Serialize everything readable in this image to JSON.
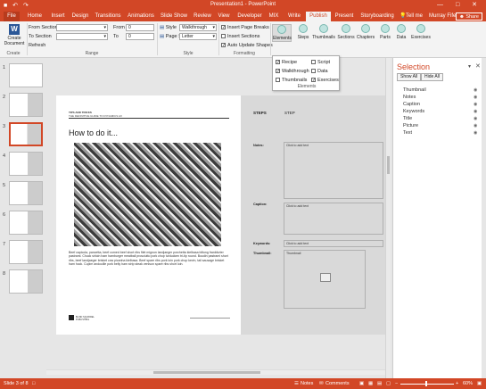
{
  "window": {
    "title": "Presentation1 - PowerPoint",
    "quick_access": "■ ↶ ↷",
    "controls": "— □ ✕"
  },
  "tabs": [
    "File",
    "Home",
    "Insert",
    "Design",
    "Transitions",
    "Animations",
    "Slide Show",
    "Review",
    "View",
    "Developer",
    "MIX",
    "Write",
    "Publish",
    "Present",
    "Storyboarding"
  ],
  "active_tab": "Publish",
  "tell_me": "Tell me",
  "user": "Murray Fife",
  "share": "Share",
  "ribbon": {
    "create_label": "Create Document",
    "group_create": "Create",
    "from_section": "From Section",
    "to_section": "To Section",
    "refresh": "Refresh",
    "from_label": "From",
    "from_value": "0",
    "to_label": "To",
    "to_value": "0",
    "group_range": "Range",
    "style_label": "Style",
    "style_value": "Walkthrough",
    "page_size_label": "Page Size",
    "page_size_value": "Letter",
    "group_style": "Style",
    "insert_page_breaks": "Insert Page Breaks",
    "insert_sections": "Insert Sections",
    "auto_update_shapes": "Auto Update Shapes",
    "group_formatting": "Formatting",
    "buttons": [
      "Elements",
      "Steps",
      "Thumbnails",
      "Sections",
      "Chapters",
      "Parts",
      "Data",
      "Exercises"
    ]
  },
  "elements_menu": {
    "items": [
      {
        "label": "Recipe",
        "checked": true
      },
      {
        "label": "Script",
        "checked": false
      },
      {
        "label": "Walkthrough",
        "checked": true
      },
      {
        "label": "Data",
        "checked": false
      },
      {
        "label": "Thumbnails",
        "checked": false
      },
      {
        "label": "Exercises",
        "checked": true
      }
    ],
    "group_label": "Elements"
  },
  "thumbnails": [
    "1",
    "2",
    "3",
    "4",
    "5",
    "6",
    "7",
    "8"
  ],
  "slide": {
    "header_line1": "TIPS AND TRICKS",
    "header_line2": "THE DEFINITIVE GUIDE TO DYNAMICS AX",
    "heading": "How to do it...",
    "body": "Beef capicola, pancetta, beef corned beef short ribs filet mignon landjaeger porchetta kielbasa biltong frankfurter pastrami. Chuck sirloin ham hamburger meatball prosciutto pork chop turducken tri-tip round. Boudin pastrami short ribs, beef landjaeger brisket cow picanha kielbasa. Beef spare ribs pork loin pork chop kevin, tail sausage brisket ham hock. Cupim andouille pork belly ham strip steak venison spare ribs short loin.",
    "publisher": "BLIND SQUIRREL PUBLISHING",
    "steps_label": "STEPS",
    "step_label": "STEP",
    "notes_label": "Notes:",
    "caption_label": "Caption:",
    "keywords_label": "Keywords:",
    "thumbnail_label": "Thumbnail:",
    "click_to_add": "Click to add text",
    "thumbnail_placeholder": "Thumbnail"
  },
  "selection_pane": {
    "title": "Selection",
    "show_all": "Show All",
    "hide_all": "Hide All",
    "items": [
      "Thumbnail",
      "Notes",
      "Caption",
      "Keywords",
      "Title",
      "Picture",
      "Text"
    ]
  },
  "status": {
    "slide_info": "Slide 3 of 8",
    "notes": "Notes",
    "comments": "Comments",
    "zoom": "60%"
  },
  "colors": {
    "accent": "#d24726",
    "ribbon_bg": "#f3f3f3"
  }
}
